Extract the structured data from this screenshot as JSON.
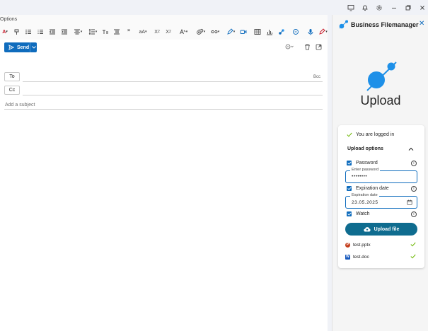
{
  "compose": {
    "options_tab": "Options",
    "send_label": "Send",
    "to_label": "To",
    "cc_label": "Cc",
    "bcc_label": "Bcc",
    "subject_placeholder": "Add a subject"
  },
  "pane": {
    "title": "Business Filemanager",
    "heading": "Upload",
    "status": "You are logged in",
    "section_title": "Upload options",
    "password_label": "Password",
    "password_field_legend": "Enter password",
    "password_value": "••••••••",
    "expiration_label": "Expiration date",
    "expiration_field_legend": "Expiration date",
    "expiration_value": "23.05.2025",
    "watch_label": "Watch",
    "upload_button": "Upload file",
    "files": [
      {
        "name": "test.pptx",
        "type": "powerpoint",
        "color": "#c43e1c"
      },
      {
        "name": "test.doc",
        "type": "word",
        "color": "#185abd"
      }
    ]
  },
  "colors": {
    "accent": "#0f6cbd",
    "logo": "#1e90e8",
    "success": "#6bb700",
    "upload_button": "#0f6c8f"
  }
}
